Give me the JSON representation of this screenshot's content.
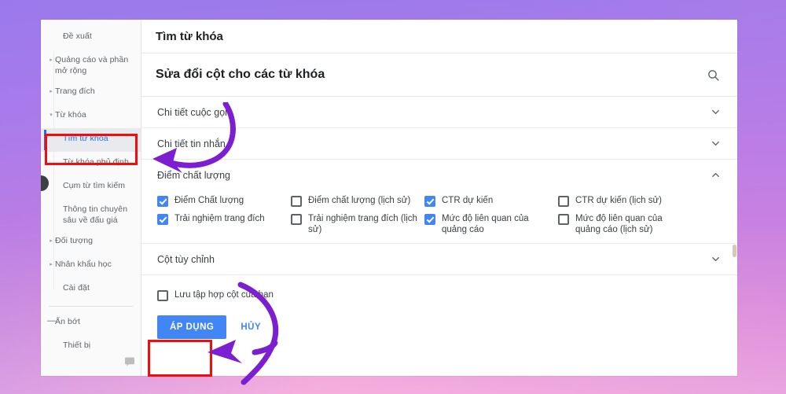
{
  "theme": {
    "accent_blue": "#4285f4",
    "selected_blue": "#1a73e8",
    "annotation_red": "#f40b0b",
    "annotation_purple": "#7b1fd1",
    "bg_gradient_top": "#9d7aea",
    "bg_gradient_bottom": "#f6b0dd"
  },
  "sidebar": {
    "items": [
      {
        "label": "Đề xuất",
        "arrow": "",
        "selected": false,
        "indent": true
      },
      {
        "label": "Quảng cáo và phần mở rộng",
        "arrow": "▸",
        "selected": false,
        "indent": false
      },
      {
        "label": "Trang đích",
        "arrow": "▸",
        "selected": false,
        "indent": false
      },
      {
        "label": "Từ khóa",
        "arrow": "▾",
        "selected": false,
        "indent": false
      },
      {
        "label": "Tìm từ khóa",
        "arrow": "",
        "selected": true,
        "indent": true
      },
      {
        "label": "Từ khóa phủ định",
        "arrow": "",
        "selected": false,
        "indent": true
      },
      {
        "label": "Cụm từ tìm kiếm",
        "arrow": "",
        "selected": false,
        "indent": true
      },
      {
        "label": "Thông tin chuyên sâu về đấu giá",
        "arrow": "",
        "selected": false,
        "indent": true
      },
      {
        "label": "Đối tượng",
        "arrow": "▸",
        "selected": false,
        "indent": false
      },
      {
        "label": "Nhân khẩu học",
        "arrow": "▸",
        "selected": false,
        "indent": false
      },
      {
        "label": "Cài đặt",
        "arrow": "",
        "selected": false,
        "indent": true
      }
    ],
    "collapse": {
      "label": "Ẩn bớt",
      "arrow": "—"
    },
    "footer_item": {
      "label": "Thiết bị"
    },
    "feedback_icon": "feedback-chat-icon"
  },
  "main": {
    "page_title": "Tìm từ khóa",
    "dialog_title": "Sửa đổi cột cho các từ khóa",
    "search_icon": "search-icon",
    "sections": [
      {
        "label": "Chi tiết cuộc gọi",
        "state": "collapsed",
        "chevron": "chevron-down-icon"
      },
      {
        "label": "Chi tiết tin nhắn",
        "state": "collapsed",
        "chevron": "chevron-down-icon"
      },
      {
        "label": "Điểm chất lượng",
        "state": "expanded",
        "chevron": "chevron-up-icon"
      }
    ],
    "quality_checkboxes": [
      {
        "label": "Điểm Chất lượng",
        "checked": true
      },
      {
        "label": "Điểm chất lượng (lịch sử)",
        "checked": false
      },
      {
        "label": "CTR dự kiến",
        "checked": true
      },
      {
        "label": "CTR dự kiến (lịch sử)",
        "checked": false
      },
      {
        "label": "Trải nghiệm trang đích",
        "checked": true
      },
      {
        "label": "Trải nghiệm trang đích (lịch sử)",
        "checked": false
      },
      {
        "label": "Mức độ liên quan của quảng cáo",
        "checked": true
      },
      {
        "label": "Mức độ liên quan của quảng cáo (lịch sử)",
        "checked": false
      }
    ],
    "custom_columns_section": {
      "label": "Cột tùy chỉnh",
      "state": "collapsed",
      "chevron": "chevron-down-icon"
    },
    "save_set": {
      "label": "Lưu tập hợp cột của bạn",
      "checked": false
    },
    "buttons": {
      "apply": "ÁP DỤNG",
      "cancel": "HỦY"
    }
  },
  "annotations": {
    "highlight_boxes": [
      {
        "name": "sidebar-selected-highlight"
      },
      {
        "name": "apply-button-highlight"
      }
    ],
    "arrows": [
      {
        "name": "arrow-to-sidebar",
        "direction": "left"
      },
      {
        "name": "arrow-to-apply-button",
        "direction": "left"
      }
    ]
  }
}
